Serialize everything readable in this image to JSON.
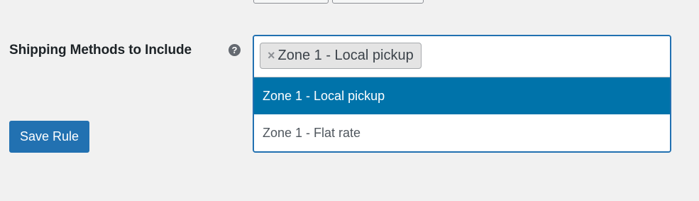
{
  "form": {
    "field_label": "Shipping Methods to Include",
    "help_icon_glyph": "?",
    "help_icon": "question-circle-icon"
  },
  "select": {
    "selected_chips": [
      {
        "label": "Zone 1 - Local pickup",
        "remove_glyph": "×"
      }
    ],
    "options": [
      {
        "label": "Zone 1 - Local pickup",
        "highlighted": true
      },
      {
        "label": "Zone 1 - Flat rate",
        "highlighted": false
      }
    ],
    "focus_border_color": "#2271b1",
    "highlight_color": "#0073aa"
  },
  "actions": {
    "save_label": "Save Rule",
    "button_color": "#2271b1"
  }
}
